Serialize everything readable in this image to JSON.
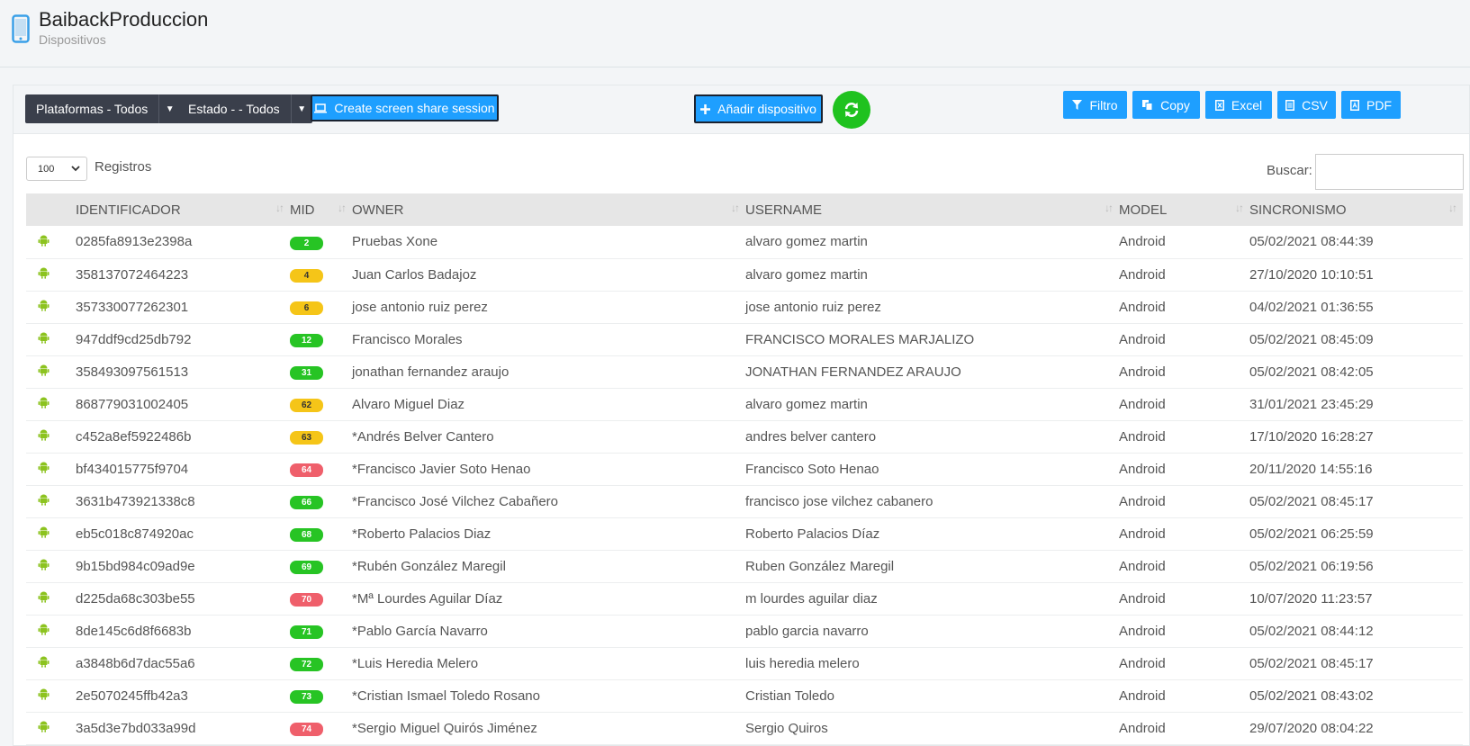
{
  "header": {
    "title": "BaibackProduccion",
    "subtitle": "Dispositivos",
    "icon": "mobile-phone-icon"
  },
  "toolbar": {
    "platform_filter": "Plataformas - Todos",
    "state_filter": "Estado - - Todos",
    "screen_share_label": "Create screen share session",
    "add_device_label": "Añadir dispositivo",
    "filter_label": "Filtro",
    "copy_label": "Copy",
    "excel_label": "Excel",
    "csv_label": "CSV",
    "pdf_label": "PDF",
    "accent_color": "#1e9fff",
    "refresh_color": "#1fc21f"
  },
  "controls": {
    "page_length": "100",
    "page_length_label": "Registros",
    "search_label": "Buscar:",
    "search_value": ""
  },
  "table": {
    "columns": [
      "IDENTIFICADOR",
      "MID",
      "OWNER",
      "USERNAME",
      "MODEL",
      "SINCRONISMO"
    ],
    "rows": [
      {
        "id": "0285fa8913e2398a",
        "mid": "2",
        "status": "green",
        "owner": "Pruebas Xone",
        "username": "alvaro gomez martin",
        "model": "Android",
        "sync": "05/02/2021 08:44:39"
      },
      {
        "id": "358137072464223",
        "mid": "4",
        "status": "yellow",
        "owner": "Juan Carlos Badajoz",
        "username": "alvaro gomez martin",
        "model": "Android",
        "sync": "27/10/2020 10:10:51"
      },
      {
        "id": "357330077262301",
        "mid": "6",
        "status": "yellow",
        "owner": "jose antonio ruiz perez",
        "username": "jose antonio ruiz perez",
        "model": "Android",
        "sync": "04/02/2021 01:36:55"
      },
      {
        "id": "947ddf9cd25db792",
        "mid": "12",
        "status": "green",
        "owner": "Francisco Morales",
        "username": "FRANCISCO MORALES MARJALIZO",
        "model": "Android",
        "sync": "05/02/2021 08:45:09"
      },
      {
        "id": "358493097561513",
        "mid": "31",
        "status": "green",
        "owner": "jonathan fernandez araujo",
        "username": "JONATHAN FERNANDEZ ARAUJO",
        "model": "Android",
        "sync": "05/02/2021 08:42:05"
      },
      {
        "id": "868779031002405",
        "mid": "62",
        "status": "yellow",
        "owner": "Alvaro Miguel Diaz",
        "username": "alvaro gomez martin",
        "model": "Android",
        "sync": "31/01/2021 23:45:29"
      },
      {
        "id": "c452a8ef5922486b",
        "mid": "63",
        "status": "yellow",
        "owner": "*Andrés Belver Cantero",
        "username": "andres belver cantero",
        "model": "Android",
        "sync": "17/10/2020 16:28:27"
      },
      {
        "id": "bf434015775f9704",
        "mid": "64",
        "status": "red",
        "owner": "*Francisco Javier Soto Henao",
        "username": "Francisco Soto Henao",
        "model": "Android",
        "sync": "20/11/2020 14:55:16"
      },
      {
        "id": "3631b473921338c8",
        "mid": "66",
        "status": "green",
        "owner": "*Francisco José Vilchez Cabañero",
        "username": "francisco jose vilchez cabanero",
        "model": "Android",
        "sync": "05/02/2021 08:45:17"
      },
      {
        "id": "eb5c018c874920ac",
        "mid": "68",
        "status": "green",
        "owner": "*Roberto Palacios Diaz",
        "username": "Roberto Palacios Díaz",
        "model": "Android",
        "sync": "05/02/2021 06:25:59"
      },
      {
        "id": "9b15bd984c09ad9e",
        "mid": "69",
        "status": "green",
        "owner": "*Rubén González Maregil",
        "username": "Ruben González Maregil",
        "model": "Android",
        "sync": "05/02/2021 06:19:56"
      },
      {
        "id": "d225da68c303be55",
        "mid": "70",
        "status": "red",
        "owner": "*Mª Lourdes Aguilar Díaz",
        "username": "m lourdes aguilar diaz",
        "model": "Android",
        "sync": "10/07/2020 11:23:57"
      },
      {
        "id": "8de145c6d8f6683b",
        "mid": "71",
        "status": "green",
        "owner": "*Pablo García Navarro",
        "username": "pablo garcia navarro",
        "model": "Android",
        "sync": "05/02/2021 08:44:12"
      },
      {
        "id": "a3848b6d7dac55a6",
        "mid": "72",
        "status": "green",
        "owner": "*Luis Heredia Melero",
        "username": "luis heredia melero",
        "model": "Android",
        "sync": "05/02/2021 08:45:17"
      },
      {
        "id": "2e5070245ffb42a3",
        "mid": "73",
        "status": "green",
        "owner": "*Cristian Ismael Toledo Rosano",
        "username": "Cristian Toledo",
        "model": "Android",
        "sync": "05/02/2021 08:43:02"
      },
      {
        "id": "3a5d3e7bd033a99d",
        "mid": "74",
        "status": "red",
        "owner": "*Sergio Miguel Quirós Jiménez",
        "username": "Sergio Quiros",
        "model": "Android",
        "sync": "29/07/2020 08:04:22"
      }
    ]
  }
}
